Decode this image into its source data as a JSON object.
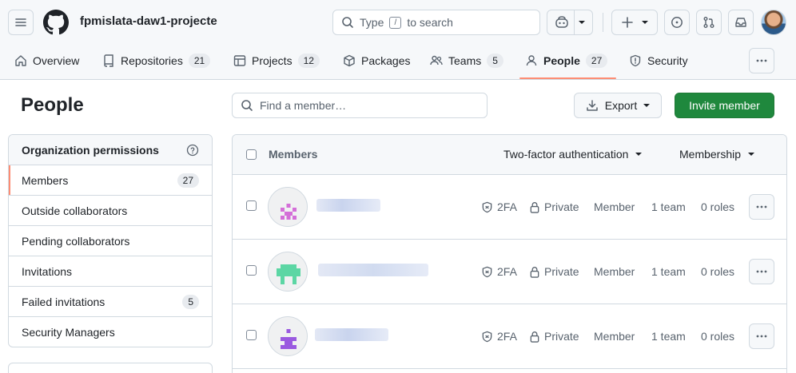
{
  "header": {
    "org_name": "fpmislata-daw1-projecte",
    "search_prefix": "Type",
    "search_key": "/",
    "search_suffix": "to search"
  },
  "tabs": [
    {
      "label": "Overview",
      "icon": "home-icon"
    },
    {
      "label": "Repositories",
      "count": "21",
      "icon": "repo-icon"
    },
    {
      "label": "Projects",
      "count": "12",
      "icon": "table-icon"
    },
    {
      "label": "Packages",
      "icon": "package-icon"
    },
    {
      "label": "Teams",
      "count": "5",
      "icon": "people-icon"
    },
    {
      "label": "People",
      "count": "27",
      "icon": "person-icon",
      "active": true
    },
    {
      "label": "Security",
      "icon": "shield-icon"
    }
  ],
  "page": {
    "title": "People",
    "search_placeholder": "Find a member…",
    "export_label": "Export",
    "invite_label": "Invite member"
  },
  "sidebar": {
    "heading": "Organization permissions",
    "items": [
      {
        "label": "Members",
        "count": "27"
      },
      {
        "label": "Outside collaborators"
      },
      {
        "label": "Pending collaborators"
      },
      {
        "label": "Invitations"
      },
      {
        "label": "Failed invitations",
        "count": "5"
      },
      {
        "label": "Security Managers"
      }
    ]
  },
  "table": {
    "col_members": "Members",
    "col_2fa": "Two-factor authentication",
    "col_membership": "Membership",
    "rows": [
      {
        "twofa": "2FA",
        "visibility": "Private",
        "role": "Member",
        "teams": "1 team",
        "roles": "0 roles",
        "avatar_color": "#d46fd8"
      },
      {
        "twofa": "2FA",
        "visibility": "Private",
        "role": "Member",
        "teams": "1 team",
        "roles": "0 roles",
        "avatar_color": "#5cd6a4"
      },
      {
        "twofa": "2FA",
        "visibility": "Private",
        "role": "Member",
        "teams": "1 team",
        "roles": "0 roles",
        "avatar_color": "#9a5ae0"
      }
    ]
  }
}
